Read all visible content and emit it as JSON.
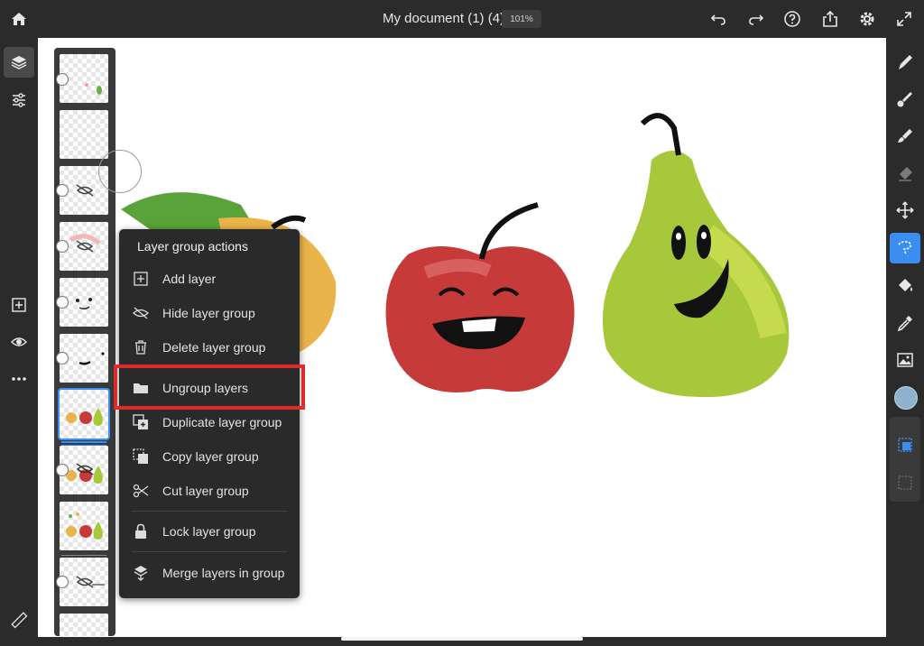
{
  "header": {
    "title": "My document (1) (4)",
    "zoom": "101%"
  },
  "topbar_icons": [
    "home-icon",
    "undo-icon",
    "redo-icon",
    "help-icon",
    "share-icon",
    "settings-icon",
    "fullscreen-icon"
  ],
  "left_tools": [
    "layers-icon",
    "adjust-icon",
    "add-layer-icon",
    "visibility-icon",
    "more-icon",
    "ruler-icon"
  ],
  "right_tools": [
    "pixel-brush-icon",
    "live-brush-icon",
    "vector-brush-icon",
    "eraser-icon",
    "transform-icon",
    "selection-icon",
    "fill-icon",
    "eyedropper-icon",
    "image-icon",
    "color-swatch",
    "select-layer-icon",
    "deselect-icon"
  ],
  "colors": {
    "accent": "#3b8ef0",
    "highlight": "#dd2c2c",
    "color_swatch": "#8fb3cf"
  },
  "menu": {
    "title": "Layer group actions",
    "items": [
      {
        "label": "Add layer",
        "icon": "add-layer-icon"
      },
      {
        "label": "Hide layer group",
        "icon": "hide-icon"
      },
      {
        "label": "Delete layer group",
        "icon": "trash-icon"
      },
      {
        "label": "Ungroup layers",
        "icon": "folder-icon"
      },
      {
        "label": "Duplicate layer group",
        "icon": "duplicate-icon"
      },
      {
        "label": "Copy layer group",
        "icon": "copy-icon"
      },
      {
        "label": "Cut layer group",
        "icon": "scissors-icon"
      },
      {
        "label": "Lock layer group",
        "icon": "lock-icon"
      },
      {
        "label": "Merge layers in group",
        "icon": "merge-icon"
      }
    ]
  }
}
